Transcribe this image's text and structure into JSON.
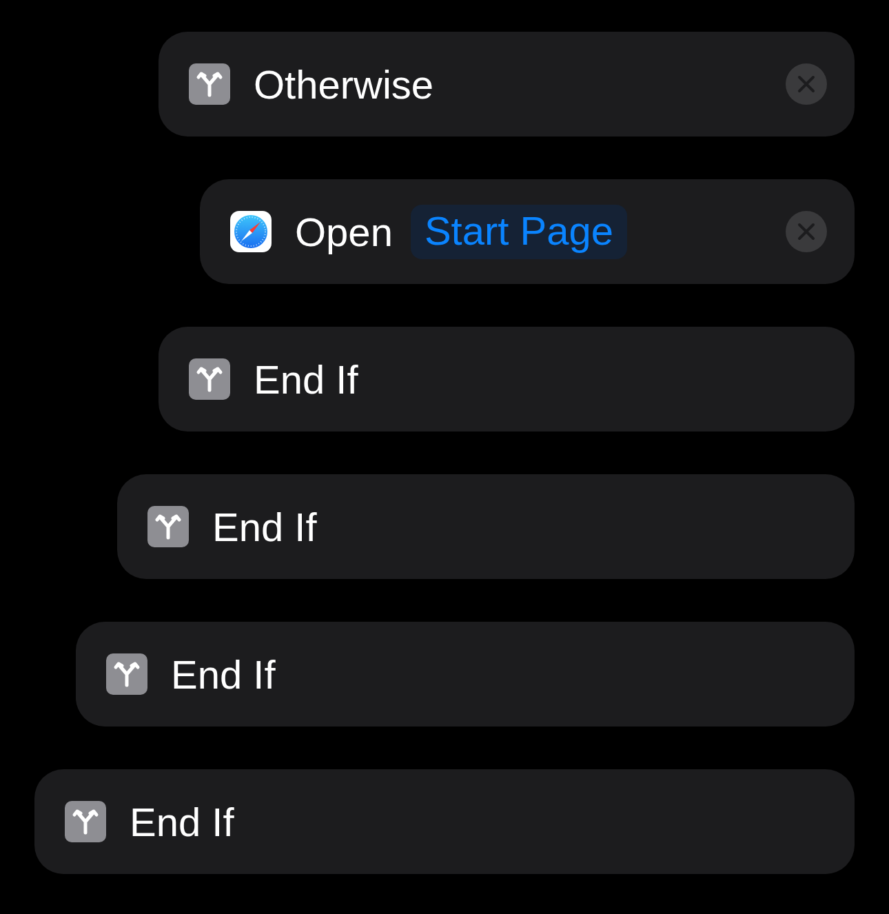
{
  "actions": [
    {
      "kind": "block",
      "children": [
        {
          "kind": "block",
          "children": [
            {
              "kind": "block",
              "children": [
                {
                  "kind": "control",
                  "title": "Otherwise",
                  "removable": true,
                  "children": [
                    {
                      "kind": "app",
                      "title": "Open",
                      "parameter": "Start Page",
                      "removable": true
                    }
                  ]
                },
                {
                  "kind": "control",
                  "title": "End If",
                  "removable": false
                }
              ]
            },
            {
              "kind": "control",
              "title": "End If",
              "removable": false
            }
          ]
        },
        {
          "kind": "control",
          "title": "End If",
          "removable": false
        }
      ]
    },
    {
      "kind": "control",
      "title": "End If",
      "removable": false
    }
  ]
}
